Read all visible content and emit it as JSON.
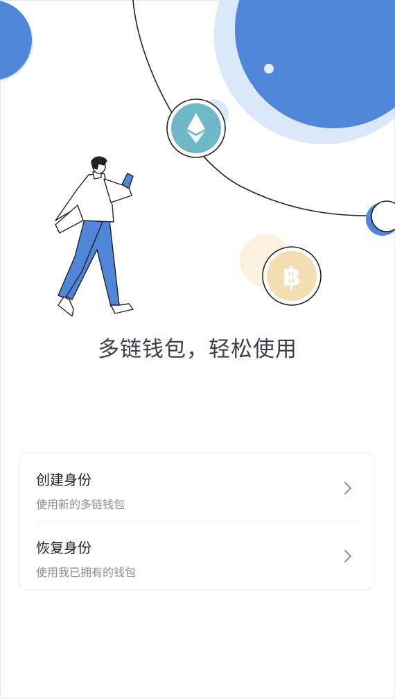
{
  "tagline": "多链钱包，轻松使用",
  "options": [
    {
      "title": "创建身份",
      "subtitle": "使用新的多链钱包",
      "icon": "chevron-right-icon"
    },
    {
      "title": "恢复身份",
      "subtitle": "使用我已拥有的钱包",
      "icon": "chevron-right-icon"
    }
  ],
  "illustration": {
    "coins": [
      "ethereum-coin-icon",
      "bitcoin-coin-icon"
    ],
    "figure": "walking-person-with-phone"
  },
  "colors": {
    "primary_blue": "#4f86d8",
    "light_blue": "#dbe8fa",
    "eth_teal": "#6fb8c7",
    "btc_tan": "#f3ddb3"
  }
}
